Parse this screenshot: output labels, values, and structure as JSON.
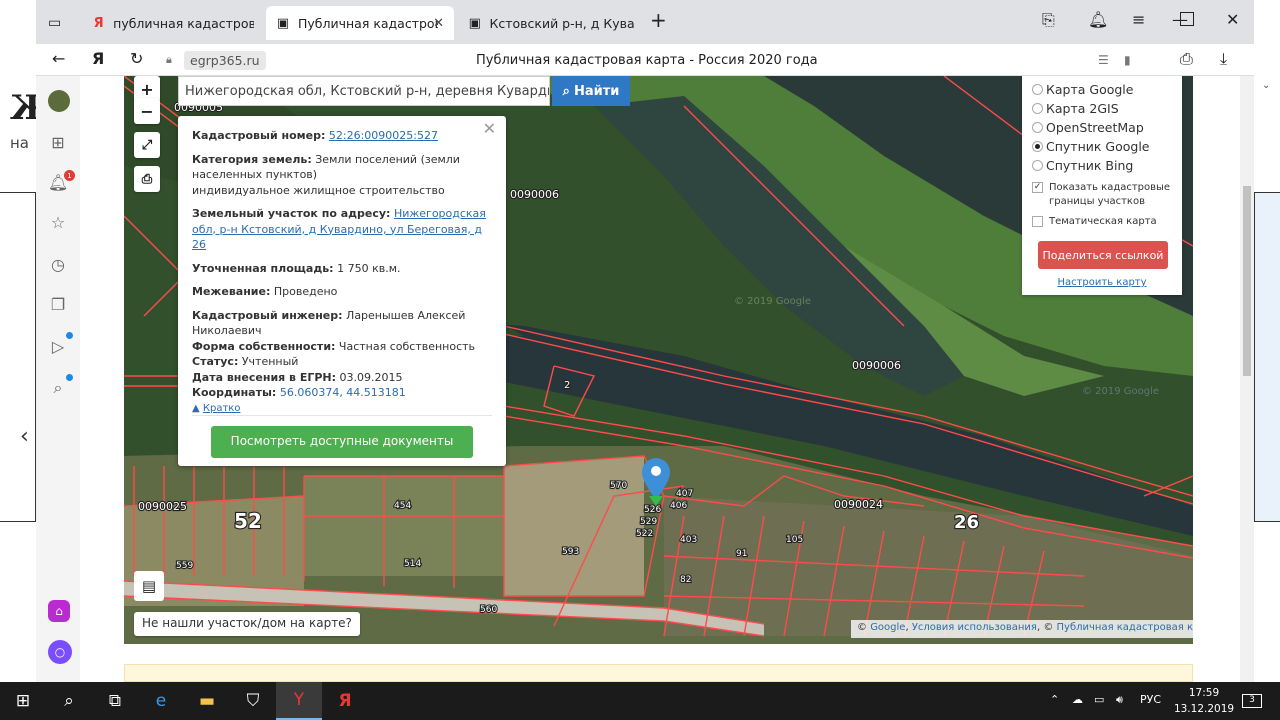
{
  "tabs": [
    {
      "icon": "Я",
      "title": "публичная кадастровая к"
    },
    {
      "icon": "▣",
      "title": "Публичная кадастровая"
    },
    {
      "icon": "▣",
      "title": "Кстовский р-н, д Кувардин"
    }
  ],
  "address": {
    "domain": "egrp365.ru",
    "page_title": "Публичная кадастровая карта - Россия 2020 года"
  },
  "search": {
    "value": "Нижегородская обл, Кстовский р-н, деревня Кувардино, ул",
    "button": "Найти"
  },
  "parcel": {
    "cad_label": "Кадастровый номер:",
    "cad_value": "52:26:0090025:527",
    "cat_label": "Категория земель:",
    "cat_value": "Земли поселений (земли населенных пунктов)",
    "cat_use": "индивидуальное жилищное строительство",
    "addr_label": "Земельный участок по адресу:",
    "addr_value": "Нижегородская обл, р-н Кстовский, д Кувардино, ул Береговая, д 26",
    "area_label": "Уточненная площадь:",
    "area_value": "1 750 кв.м.",
    "survey_label": "Межевание:",
    "survey_value": "Проведено",
    "eng_label": "Кадастровый инженер:",
    "eng_value": "Ларенышев Алексей Николаевич",
    "own_label": "Форма собственности:",
    "own_value": "Частная собственность",
    "status_label": "Статус:",
    "status_value": "Учтенный",
    "date_label": "Дата внесения в ЕГРН:",
    "date_value": "03.09.2015",
    "coord_label": "Координаты:",
    "coord_value": "56.060374, 44.513181",
    "brief": "Кратко",
    "docs_button": "Посмотреть доступные документы"
  },
  "layers": {
    "options": [
      "Карта Google",
      "Карта 2GIS",
      "OpenStreetMap",
      "Спутник Google",
      "Спутник Bing"
    ],
    "selected": "Спутник Google",
    "show_bounds": "Показать кадастровые границы участков",
    "thematic": "Тематическая карта",
    "share": "Поделиться ссылкой",
    "configure": "Настроить карту"
  },
  "map_labels": {
    "q1": "0090005",
    "q2": "0090006",
    "q3": "0090006",
    "q4": "0090024",
    "q5": "0090025",
    "big52": "52",
    "big26": "26",
    "p454": "454",
    "p593": "593",
    "p514": "514",
    "p559": "559",
    "p560": "560",
    "p570": "570",
    "p526": "526",
    "p529": "529",
    "p522": "522",
    "p403": "403",
    "p407": "407",
    "p406": "406",
    "p82": "82",
    "p91": "91",
    "p105": "105",
    "p2": "2",
    "watermark1": "© 2019 Google",
    "watermark2": "© 2019 Google"
  },
  "not_found": "Не нашли участок/дом на карте?",
  "attribution": {
    "prefix": "©",
    "google": "Google",
    "terms": "Условия использования",
    "pkk": "Публичная кадастровая карта"
  },
  "sidebar": {
    "notif_count": "1"
  },
  "clock": {
    "time": "17:59",
    "date": "13.12.2019"
  },
  "tray": {
    "lang": "РУС",
    "notif": "3"
  },
  "desktop": {
    "left_text": "на"
  }
}
